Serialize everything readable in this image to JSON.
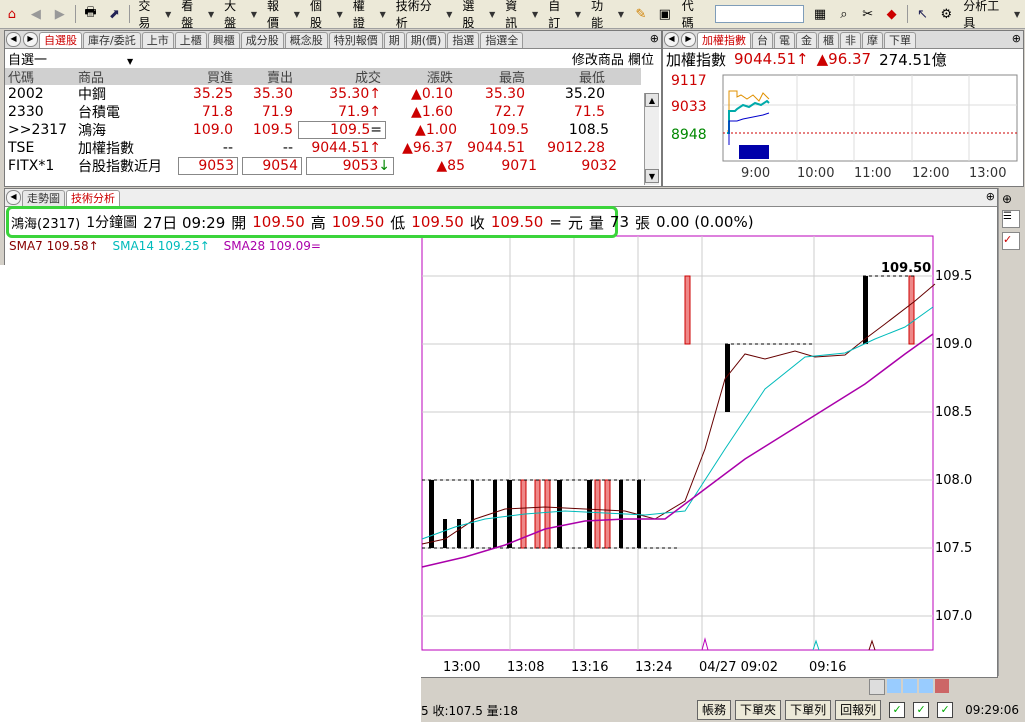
{
  "toolbar": {
    "menus": [
      "交易",
      "看盤",
      "大盤",
      "報價",
      "個股",
      "權證",
      "技術分析",
      "選股",
      "資訊",
      "自訂",
      "功能"
    ],
    "code_label": "代碼",
    "analysis_tools": "分析工具"
  },
  "quote": {
    "tabs": [
      "自選股",
      "庫存/委託",
      "上市",
      "上櫃",
      "興櫃",
      "成分股",
      "概念股",
      "特別報價",
      "期",
      "期(價)",
      "指選",
      "指選全"
    ],
    "active_tab": "自選股",
    "group": "自選一",
    "edit_links": "修改商品 欄位",
    "headers": [
      "代碼",
      "商品",
      "買進",
      "賣出",
      "成交",
      "漲跌",
      "最高",
      "最低"
    ],
    "rows": [
      {
        "code": "2002",
        "name": "中鋼",
        "bid": "35.25",
        "ask": "35.30",
        "last": "35.30",
        "arrow": "↑",
        "chg": "▲0.10",
        "high": "35.30",
        "low": "35.20"
      },
      {
        "code": "2330",
        "name": "台積電",
        "bid": "71.8",
        "ask": "71.9",
        "last": "71.9",
        "arrow": "↑",
        "chg": "▲1.60",
        "high": "72.7",
        "low": "71.5"
      },
      {
        "code": ">>2317",
        "name": "鴻海",
        "bid": "109.0",
        "ask": "109.5",
        "last": "109.5",
        "arrow": "=",
        "chg": "▲1.00",
        "high": "109.5",
        "low": "108.5"
      },
      {
        "code": "TSE",
        "name": "加權指數",
        "bid": "--",
        "ask": "--",
        "last": "9044.51",
        "arrow": "↑",
        "chg": "▲96.37",
        "high": "9044.51",
        "low": "9012.28"
      },
      {
        "code": "FITX*1",
        "name": "台股指數近月",
        "bid": "9053",
        "ask": "9054",
        "last": "9053",
        "arrow": "↓",
        "chg": "▲85",
        "high": "9071",
        "low": "9032"
      }
    ]
  },
  "index": {
    "tabs": [
      "加權指數",
      "台",
      "電",
      "金",
      "櫃",
      "非",
      "摩",
      "下單"
    ],
    "name": "加權指數",
    "value": "9044.51",
    "arrow": "↑",
    "change": "▲96.37",
    "volume": "274.51億",
    "y_labels": [
      "9117",
      "9033",
      "8948"
    ],
    "x_labels": [
      "9:00",
      "10:00",
      "11:00",
      "12:00",
      "13:00"
    ]
  },
  "chart": {
    "tabs": [
      "走勢圖",
      "技術分析"
    ],
    "info": {
      "stock": "鴻海(2317)",
      "period": "1分鐘圖",
      "datetime": "27日 09:29",
      "open_label": "開",
      "open": "109.50",
      "high_label": "高",
      "high": "109.50",
      "low_label": "低",
      "low": "109.50",
      "close_label": "收",
      "close": "109.50",
      "eq": "=",
      "unit": "元",
      "vol_label": "量",
      "vol": "73",
      "vol_unit": "張",
      "change": "0.00 (0.00%)"
    },
    "sma_labels": [
      "SMA7 109.58↑",
      "SMA14 109.25↑",
      "SMA28 109.09="
    ],
    "last_label": "109.50",
    "y_ticks": [
      "109.5",
      "109.0",
      "108.5",
      "108.0",
      "107.5",
      "107.0"
    ],
    "x_ticks": [
      "13:00",
      "13:08",
      "13:16",
      "13:24",
      "04/27 09:02",
      "09:16"
    ]
  },
  "status": {
    "text": "5 收:107.5 量:18",
    "buttons": [
      "帳務",
      "下單夾",
      "下單列",
      "回報列"
    ],
    "time": "09:29:06"
  }
}
